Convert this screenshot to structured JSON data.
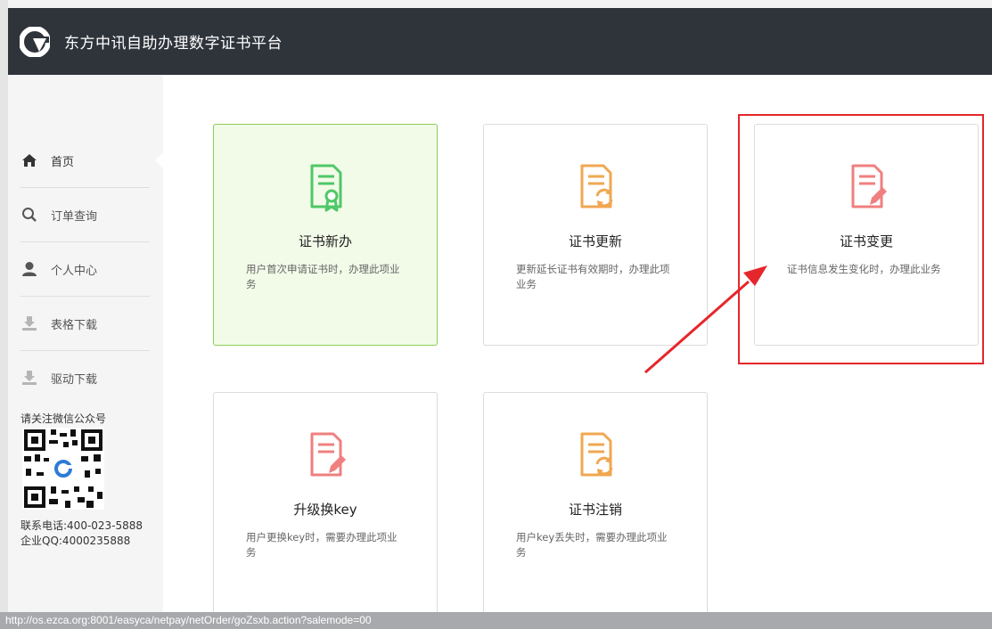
{
  "header": {
    "title": "东方中讯自助办理数字证书平台"
  },
  "sidebar": {
    "items": [
      {
        "label": "首页",
        "icon": "home-icon",
        "active": true
      },
      {
        "label": "订单查询",
        "icon": "search-icon"
      },
      {
        "label": "个人中心",
        "icon": "user-icon"
      },
      {
        "label": "表格下载",
        "icon": "download-icon"
      },
      {
        "label": "驱动下载",
        "icon": "download-icon"
      }
    ],
    "follow_text": "请关注微信公众号",
    "phone": "联系电话:400-023-5888",
    "qq": "企业QQ:4000235888"
  },
  "cards": [
    {
      "title": "证书新办",
      "desc": "用户首次申请证书时，办理此项业务",
      "icon": "certificate-badge-icon",
      "color": "#4fc768",
      "selected": true
    },
    {
      "title": "证书更新",
      "desc": "更新延长证书有效期时，办理此项业务",
      "icon": "document-refresh-icon",
      "color": "#f0a751"
    },
    {
      "title": "证书变更",
      "desc": "证书信息发生变化时，办理此业务",
      "icon": "document-edit-icon",
      "color": "#f07f7f"
    },
    {
      "title": "升级换key",
      "desc": "用户更换key时，需要办理此项业务",
      "icon": "document-edit-icon",
      "color": "#f07f7f"
    },
    {
      "title": "证书注销",
      "desc": "用户key丢失时，需要办理此项业务",
      "icon": "document-refresh-icon",
      "color": "#f0a751"
    }
  ],
  "status_url": "http://os.ezca.org:8001/easyca/netpay/netOrder/goZsxb.action?salemode=00",
  "colors": {
    "header_bg": "#2f343b",
    "highlight": "#e5262b",
    "selected_border": "#8ccc57"
  }
}
